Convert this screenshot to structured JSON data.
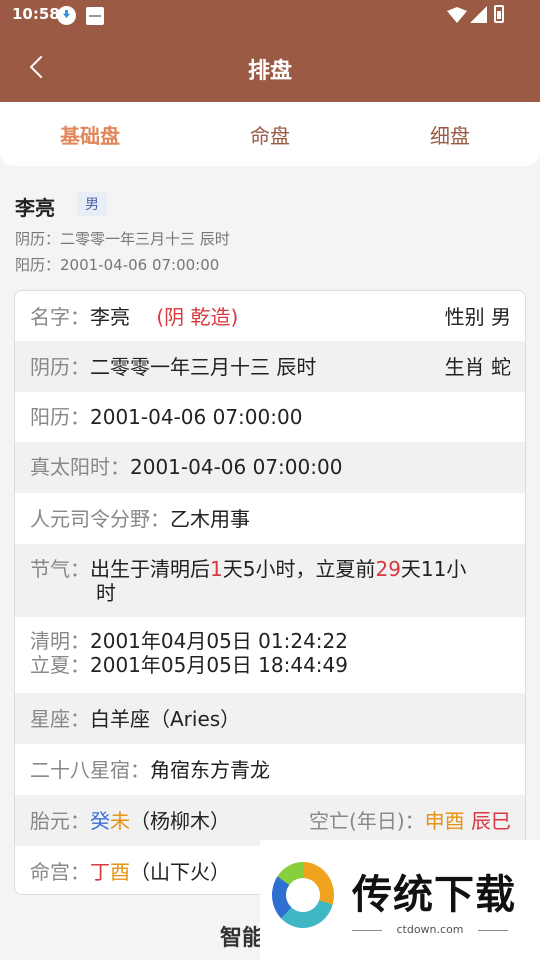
{
  "status_bar": {
    "time": "10:58"
  },
  "header": {
    "title": "排盘"
  },
  "tabs": [
    "基础盘",
    "命盘",
    "细盘"
  ],
  "person": {
    "name": "李亮",
    "gender": "男",
    "lunar_line": "阴历：二零零一年三月十三 辰时",
    "solar_line": "阳历：2001-04-06 07:00:00"
  },
  "card": {
    "name_row": {
      "label": "名字：",
      "value": "李亮",
      "tag": "(阴 乾造)",
      "right": "性别 男"
    },
    "lunar_row": {
      "label": "阴历：",
      "value": "二零零一年三月十三 辰时",
      "right": "生肖 蛇"
    },
    "solar_row": {
      "label": "阳历：",
      "value": "2001-04-06 07:00:00"
    },
    "true_solar_row": {
      "label": "真太阳时：",
      "value": "2001-04-06 07:00:00"
    },
    "siling_row": {
      "label": "人元司令分野：",
      "value": "乙木用事"
    },
    "jieqi_row": {
      "label": "节气：",
      "t1": "出生于清明后",
      "n1": "1",
      "t2": "天5小时，立夏前",
      "n2": "29",
      "t3": "天11小",
      "t4": "时"
    },
    "qingming_row": {
      "label": "清明：",
      "value": "2001年04月05日 01:24:22"
    },
    "lixia_row": {
      "label": "立夏：",
      "value": "2001年05月05日 18:44:49"
    },
    "xingzuo_row": {
      "label": "星座：",
      "value": "白羊座（Aries）"
    },
    "xingxiu_row": {
      "label": "二十八星宿：",
      "value": "角宿东方青龙"
    },
    "taiyuan_row": {
      "label": "胎元：",
      "stem": "癸",
      "branch": "未",
      "nayin": "（杨柳木）",
      "kongwang_label": "空亡(年日)：",
      "kw1": "申酉",
      "kw2": "辰巳"
    },
    "minggong_row": {
      "label": "命宫：",
      "stem": "丁",
      "branch": "酉",
      "nayin": "（山下火）"
    }
  },
  "bottom_title": "智能",
  "watermark": {
    "text": "传统下载",
    "url": "ctdown.com"
  }
}
